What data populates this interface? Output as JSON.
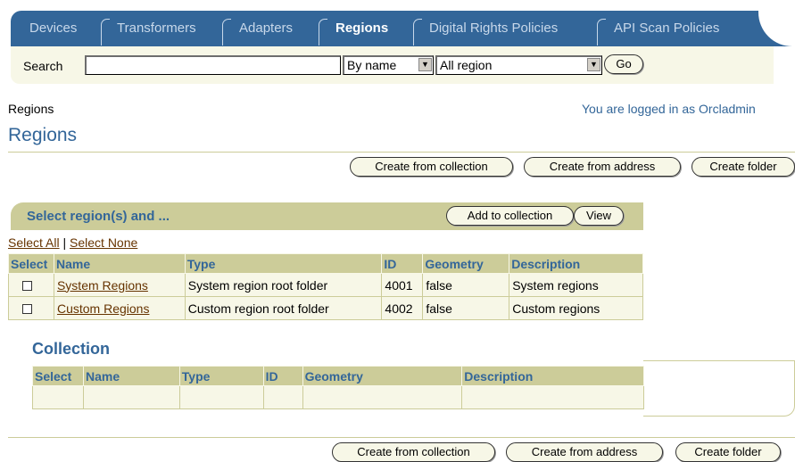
{
  "tabs": [
    {
      "label": "Devices",
      "active": false
    },
    {
      "label": "Transformers",
      "active": false
    },
    {
      "label": "Adapters",
      "active": false
    },
    {
      "label": "Regions",
      "active": true
    },
    {
      "label": "Digital Rights Policies",
      "active": false
    },
    {
      "label": "API Scan Policies",
      "active": false
    }
  ],
  "search": {
    "label": "Search",
    "value": "",
    "by": "By name",
    "scope": "All region",
    "go_label": "Go"
  },
  "breadcrumb": "Regions",
  "logged_in": "You are logged in as Orcladmin",
  "page_title": "Regions",
  "actions": {
    "create_from_collection": "Create from collection",
    "create_from_address": "Create from address",
    "create_folder": "Create folder"
  },
  "region_section": {
    "title": "Select region(s) and ...",
    "add_to_collection": "Add to collection",
    "view": "View",
    "select_all": "Select All",
    "separator": "|",
    "select_none": "Select None",
    "columns": [
      "Select",
      "Name",
      "Type",
      "ID",
      "Geometry",
      "Description"
    ],
    "rows": [
      {
        "checked": false,
        "name": "System Regions",
        "type": "System region root folder",
        "id": "4001",
        "geometry": "false",
        "description": "System regions"
      },
      {
        "checked": false,
        "name": "Custom Regions",
        "type": "Custom region root folder",
        "id": "4002",
        "geometry": "false",
        "description": "Custom regions"
      }
    ]
  },
  "collection": {
    "title": "Collection",
    "columns": [
      "Select",
      "Name",
      "Type",
      "ID",
      "Geometry",
      "Description"
    ]
  },
  "colors": {
    "tab_bar": "#336699",
    "accent_text": "#336699",
    "header_fill": "#cccc99",
    "row_fill": "#f7f7e7",
    "link": "#663300"
  }
}
